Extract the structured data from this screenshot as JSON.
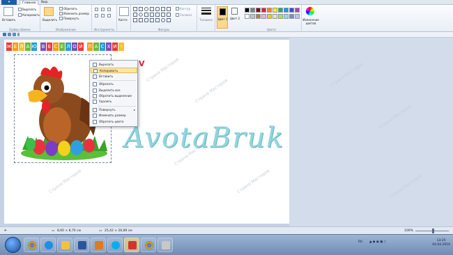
{
  "tabs": {
    "file": "",
    "home": "Главная",
    "view": "Вид"
  },
  "ribbon": {
    "clipboard": {
      "paste": "Вставить",
      "cut": "Вырезать",
      "copy": "Копировать",
      "label": "Буфер обмена"
    },
    "image": {
      "select": "Выделить",
      "crop": "Обрезать",
      "resize": "Изменить размер",
      "rotate": "Повернуть",
      "label": "Изображение"
    },
    "tools": {
      "label": "Инструменты"
    },
    "brushes": {
      "label": "Кисти"
    },
    "shapes": {
      "label": "Фигуры",
      "outline": "Контур",
      "fill": "Заливка"
    },
    "size": {
      "label": "Толщина"
    },
    "color1": {
      "label": "Цвет 1"
    },
    "color2": {
      "label": "Цвет 2"
    },
    "colors": {
      "label": "Цвета",
      "edit": "Изменение цветов"
    },
    "palette": [
      "#000000",
      "#7f7f7f",
      "#880015",
      "#ed1c24",
      "#ff7f27",
      "#fff200",
      "#22b14c",
      "#00a2e8",
      "#3f48cc",
      "#a349a4",
      "#ffffff",
      "#c3c3c3",
      "#b97a57",
      "#ffaec9",
      "#ffc90e",
      "#efe4b0",
      "#b5e61d",
      "#99d9ea",
      "#7092be",
      "#c8bfe7"
    ]
  },
  "canvas": {
    "banner_letters": [
      "Ж",
      "Е",
      "Л",
      "А",
      "Ю",
      " ",
      "В",
      "Е",
      "С",
      "Е",
      "Л",
      "О",
      "Й",
      " ",
      "П",
      "А",
      "С",
      "Х",
      "И",
      "!"
    ],
    "banner_colors": [
      "#e33b3b",
      "#f39c1b",
      "#f2c230",
      "#6fb83a",
      "#2b9bd6",
      "#ffffff",
      "#7a4fb4",
      "#e33b3b",
      "#f39c1b",
      "#6fb83a",
      "#2b9bd6",
      "#7a4fb4",
      "#e33b3b",
      "#ffffff",
      "#f39c1b",
      "#6fb83a",
      "#2b9bd6",
      "#7a4fb4",
      "#e33b3b",
      "#f2c230"
    ],
    "watermark": "AvotaBruk",
    "small_watermark": "Страна Мастеров"
  },
  "context_menu": [
    {
      "label": "Вырезать",
      "icon": "cut-icon"
    },
    {
      "label": "Копировать",
      "icon": "copy-icon",
      "highlighted": true
    },
    {
      "label": "Вставить",
      "icon": "paste-icon"
    },
    {
      "label": "Обрезать",
      "icon": "crop-icon"
    },
    {
      "label": "Выделить все",
      "icon": "select-all-icon"
    },
    {
      "label": "Обратить выделение",
      "icon": "invert-selection-icon"
    },
    {
      "label": "Удалить",
      "icon": "delete-icon"
    },
    {
      "label": "Повернуть",
      "icon": "rotate-icon",
      "submenu": true
    },
    {
      "label": "Изменить размер",
      "icon": "resize-icon"
    },
    {
      "label": "Обратить цвета",
      "icon": "invert-colors-icon"
    }
  ],
  "context_mark": "V",
  "status": {
    "selection_size": "8,60 × 8,70 см",
    "image_size": "25,42 × 26,89 см",
    "zoom": "100%"
  },
  "taskbar": {
    "lang": "RU",
    "time": "13:25",
    "date": "04.04.2016"
  }
}
